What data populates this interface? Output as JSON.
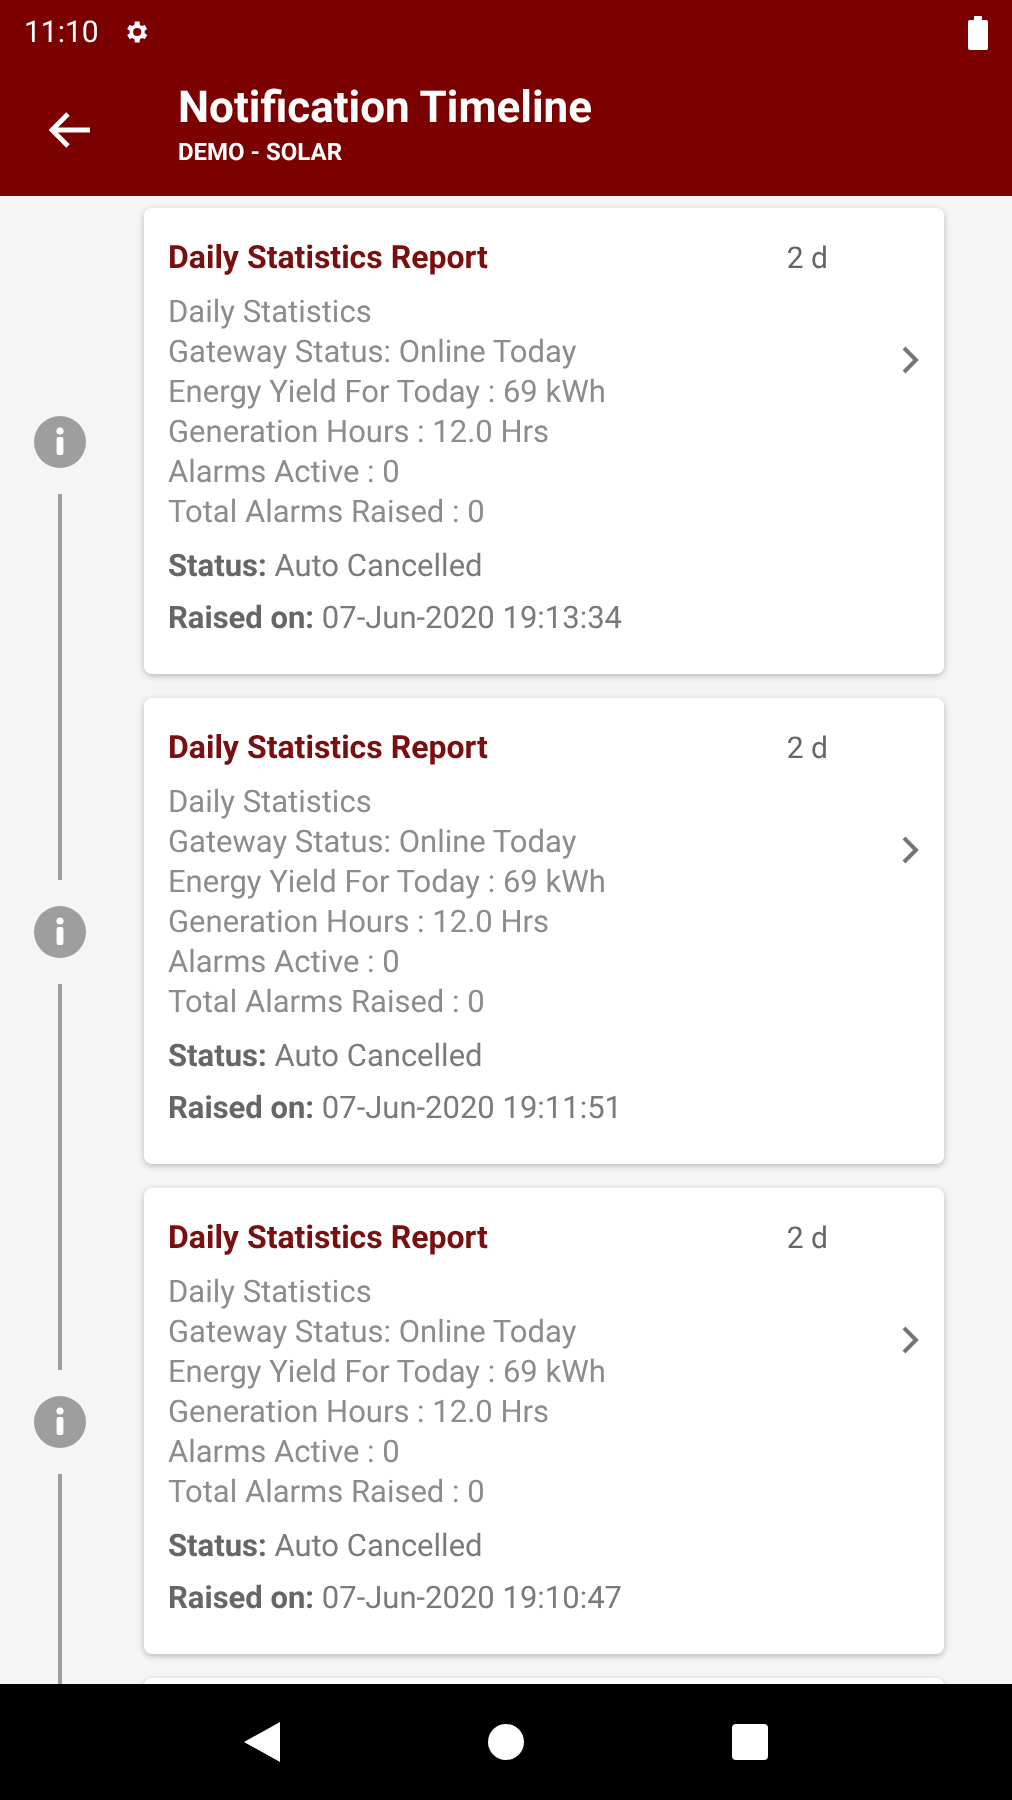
{
  "status_bar": {
    "time": "11:10"
  },
  "app_bar": {
    "title": "Notification Timeline",
    "subtitle": "DEMO - SOLAR"
  },
  "notifications": [
    {
      "title": "Daily Statistics Report",
      "age": "2 d",
      "lines": [
        "Daily Statistics",
        "Gateway Status: Online Today",
        "Energy Yield For Today : 69 kWh",
        "Generation Hours : 12.0 Hrs",
        "Alarms Active : 0",
        "Total Alarms Raised : 0"
      ],
      "status": "**Status:** Auto Cancelled",
      "raised": "**Raised on:** 07-Jun-2020 19:13:34"
    },
    {
      "title": "Daily Statistics Report",
      "age": "2 d",
      "lines": [
        "Daily Statistics",
        "Gateway Status: Online Today",
        "Energy Yield For Today : 69 kWh",
        "Generation Hours : 12.0 Hrs",
        "Alarms Active : 0",
        "Total Alarms Raised : 0"
      ],
      "status": "**Status:** Auto Cancelled",
      "raised": "**Raised on:** 07-Jun-2020 19:11:51"
    },
    {
      "title": "Daily Statistics Report",
      "age": "2 d",
      "lines": [
        "Daily Statistics",
        "Gateway Status: Online Today",
        "Energy Yield For Today : 69 kWh",
        "Generation Hours : 12.0 Hrs",
        "Alarms Active : 0",
        "Total Alarms Raised : 0"
      ],
      "status": "**Status:** Auto Cancelled",
      "raised": "**Raised on:** 07-Jun-2020 19:10:47"
    }
  ]
}
